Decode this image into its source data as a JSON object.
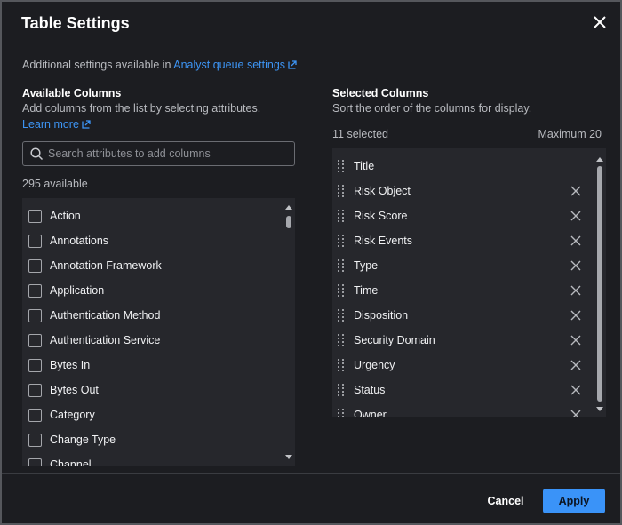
{
  "dialog": {
    "title": "Table Settings"
  },
  "note": {
    "text": "Additional settings available in ",
    "link": "Analyst queue settings"
  },
  "available": {
    "heading": "Available Columns",
    "description": "Add columns from the list by selecting attributes.",
    "learn_more": "Learn more",
    "search_placeholder": "Search attributes to add columns",
    "count": "295 available",
    "items": [
      "Action",
      "Annotations",
      "Annotation Framework",
      "Application",
      "Authentication Method",
      "Authentication Service",
      "Bytes In",
      "Bytes Out",
      "Category",
      "Change Type",
      "Channel"
    ]
  },
  "selected": {
    "heading": "Selected Columns",
    "description": "Sort the order of the columns for display.",
    "count": "11 selected",
    "max": "Maximum 20",
    "items": [
      "Title",
      "Risk Object",
      "Risk Score",
      "Risk Events",
      "Type",
      "Time",
      "Disposition",
      "Security Domain",
      "Urgency",
      "Status",
      "Owner"
    ]
  },
  "footer": {
    "cancel": "Cancel",
    "apply": "Apply"
  },
  "colors": {
    "accent": "#3a93f8",
    "link": "#3d95f5",
    "background": "#1c1d21",
    "list_background": "#26272c"
  }
}
